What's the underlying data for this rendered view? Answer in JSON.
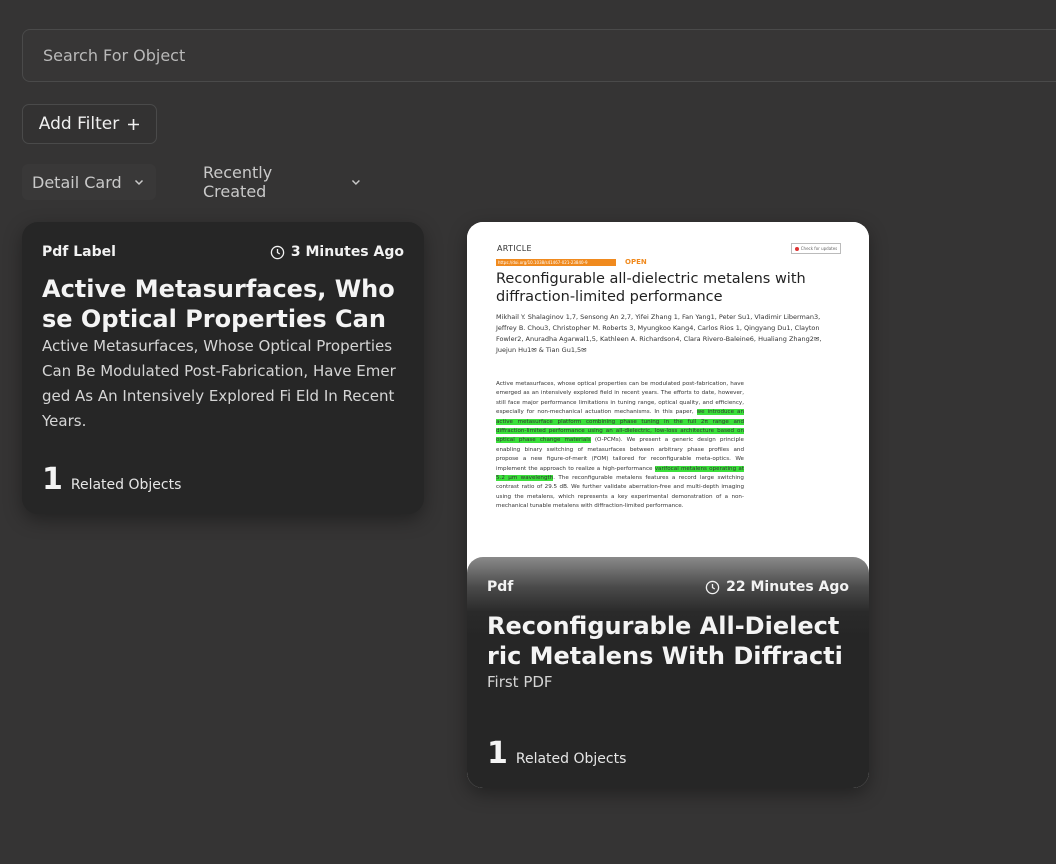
{
  "search": {
    "placeholder": "Search For Object",
    "value": ""
  },
  "filters": {
    "add_filter_label": "Add Filter",
    "add_icon": "plus-icon"
  },
  "view": {
    "mode_label": "Detail Card",
    "sort_label": "Recently Created"
  },
  "cards": [
    {
      "label": "Pdf Label",
      "time": "3 Minutes Ago",
      "title": "Active Metasurfaces, Whose Optical Properties Can ...",
      "description": "Active Metasurfaces, Whose Optical Properties Can Be Modulated Post-Fabrication, Have Emerged As An Intensively Explored Fi Eld In Recent Years.",
      "related_count": "1",
      "related_label": "Related Objects"
    },
    {
      "label": "Pdf",
      "time": "22 Minutes Ago",
      "title": "Reconfigurable All-Dielectric Metalens With Diffraction-Limit...",
      "subtitle": "First PDF",
      "related_count": "1",
      "related_label": "Related Objects",
      "preview": {
        "article": "ARTICLE",
        "check": "Check for updates",
        "doi": "https://doi.org/10.1038/s41467-021-23840-9",
        "open": "OPEN",
        "title": "Reconfigurable all-dielectric metalens with diffraction-limited performance",
        "authors": "Mikhail Y. Shalaginov 1,7, Sensong An 2,7, Yifei Zhang 1, Fan Yang1, Peter Su1, Vladimir Liberman3, Jeffrey B. Chou3, Christopher M. Roberts 3, Myungkoo Kang4, Carlos Rios 1, Qingyang Du1, Clayton Fowler2, Anuradha Agarwal1,5, Kathleen A. Richardson4, Clara Rivero-Baleine6, Hualiang Zhang2✉, Juejun Hu1✉ & Tian Gu1,5✉",
        "abstract_a": "Active metasurfaces, whose optical properties can be modulated post-fabrication, have emerged as an intensively explored field in recent years. The efforts to date, however, still face major performance limitations in tuning range, optical quality, and efficiency, especially for non-mechanical actuation mechanisms. In this paper, ",
        "abstract_h1": "we introduce an active metasurface platform combining phase tuning in the full 2π range and diffraction-limited performance using an all-dielectric, low-loss architecture based on optical phase change materials",
        "abstract_b": " (O-PCMs). We present a generic design principle enabling binary switching of metasurfaces between arbitrary phase profiles and propose a new figure-of-merit (FOM) tailored for reconfigurable meta-optics. We implement the approach to realize a high-performance ",
        "abstract_h2": "varifocal metalens operating at 5.2 μm wavelength",
        "abstract_c": ". The reconfigurable metalens features a record large switching contrast ratio of 29.5 dB. We further validate aberration-free and multi-depth imaging using the metalens, which represents a key experimental demonstration of a non-mechanical tunable metalens with diffraction-limited performance."
      }
    }
  ]
}
